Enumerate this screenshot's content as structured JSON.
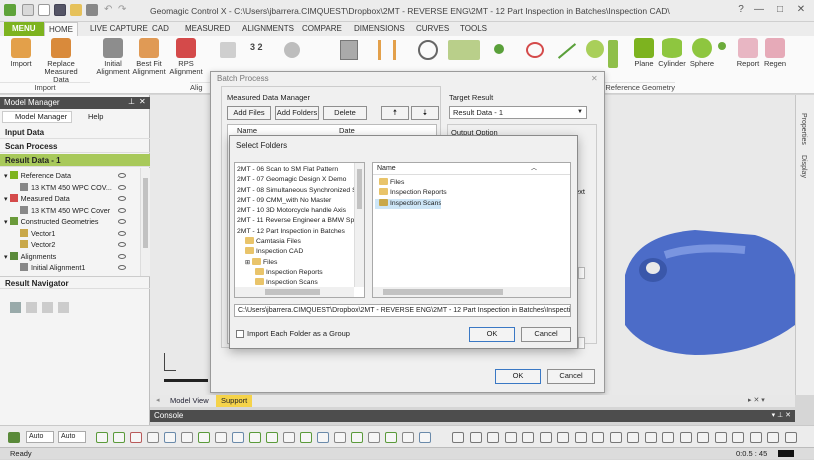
{
  "app": {
    "title": "Geomagic Control X - C:\\Users\\jbarrera.CIMQUEST\\Dropbox\\2MT - REVERSE ENG\\2MT - 12 Part Inspection in Batches\\Inspection CAD\\Inspection Complete.CXProj - [NOT FOR RESALE]"
  },
  "ribbon": {
    "tabs": [
      "MENU",
      "HOME",
      "LIVE CAPTURE",
      "CAD",
      "MEASURED",
      "ALIGNMENTS",
      "COMPARE",
      "DIMENSIONS",
      "CURVES",
      "TOOLS"
    ],
    "buttons": [
      {
        "label": "Import",
        "icon": "import-icon"
      },
      {
        "label": "Replace Measured Data",
        "icon": "replace-data-icon"
      },
      {
        "label": "Initial Alignment",
        "icon": "initial-alignment-icon"
      },
      {
        "label": "Best Fit Alignment",
        "icon": "best-fit-icon"
      },
      {
        "label": "RPS Alignment",
        "icon": "rps-alignment-icon"
      },
      {
        "label": "Plane",
        "icon": "plane-icon"
      },
      {
        "label": "Cylinder",
        "icon": "cylinder-icon"
      },
      {
        "label": "Sphere",
        "icon": "sphere-icon"
      },
      {
        "label": "Report",
        "icon": "report-icon"
      },
      {
        "label": "Regen",
        "icon": "regen-icon"
      }
    ],
    "groups": {
      "import": "Import",
      "align": "Alig",
      "ref_geometry": "Reference Geometry"
    }
  },
  "model_manager": {
    "header": "Model Manager",
    "tabs": [
      "Model Manager",
      "Help"
    ],
    "sections": {
      "input": "Input Data",
      "scan": "Scan Process",
      "result": "Result Data - 1",
      "navigator": "Result Navigator"
    },
    "tree": [
      {
        "label": "Reference Data",
        "level": 0,
        "icon": "reference-data-icon"
      },
      {
        "label": "13 KTM 450 WPC COV...",
        "level": 1,
        "icon": "cad-body-icon"
      },
      {
        "label": "Measured Data",
        "level": 0,
        "icon": "measured-data-icon"
      },
      {
        "label": "13 KTM 450 WPC Cover",
        "level": 1,
        "icon": "mesh-icon"
      },
      {
        "label": "Constructed Geometries",
        "level": 0,
        "icon": "constructed-geometry-icon"
      },
      {
        "label": "Vector1",
        "level": 1,
        "icon": "vector-icon"
      },
      {
        "label": "Vector2",
        "level": 1,
        "icon": "vector-icon"
      },
      {
        "label": "Alignments",
        "level": 0,
        "icon": "alignments-icon"
      },
      {
        "label": "Initial Alignment1",
        "level": 1,
        "icon": "alignment-icon"
      }
    ]
  },
  "batch": {
    "title": "Batch Process",
    "measured_label": "Measured Data Manager",
    "add_files": "Add Files",
    "add_folders": "Add Folders",
    "delete": "Delete",
    "col_name": "Name",
    "col_date": "Date",
    "target_label": "Target Result",
    "target_value": "Result Data - 1",
    "output_label": "Output Option",
    "text_frag": "ext",
    "ok": "OK",
    "cancel": "Cancel"
  },
  "select_folders": {
    "title": "Select Folders",
    "tree": [
      {
        "label": "2MT - 06 Scan to SM Flat Pattern",
        "indent": 0,
        "folder": false
      },
      {
        "label": "2MT - 07 Geomagic Design X Demo",
        "indent": 0,
        "folder": false
      },
      {
        "label": "2MT - 08 Simultaneous Synchronized S",
        "indent": 0,
        "folder": false
      },
      {
        "label": "2MT - 09 CMM_with No Master",
        "indent": 0,
        "folder": false
      },
      {
        "label": "2MT - 10 3D Motorcycle handle Axis",
        "indent": 0,
        "folder": false
      },
      {
        "label": "2MT - 11 Reverse Engineer a BMW Sp",
        "indent": 0,
        "folder": false
      },
      {
        "label": "2MT - 12 Part Inspection in Batches",
        "indent": 0,
        "folder": false
      },
      {
        "label": "Camtasia Files",
        "indent": 1,
        "folder": true
      },
      {
        "label": "Inspection CAD",
        "indent": 1,
        "folder": true
      },
      {
        "label": "Files",
        "indent": 2,
        "folder": true
      },
      {
        "label": "Inspection Reports",
        "indent": 2,
        "folder": true
      },
      {
        "label": "Inspection Scans",
        "indent": 2,
        "folder": true
      }
    ],
    "list_header": "Name",
    "list": [
      {
        "label": "Files",
        "selected": false
      },
      {
        "label": "Inspection Reports",
        "selected": false
      },
      {
        "label": "Inspection Scans",
        "selected": true
      }
    ],
    "path": "C:\\Users\\jbarrera.CIMQUEST\\Dropbox\\2MT - REVERSE ENG\\2MT - 12 Part Inspection in Batches\\Inspection",
    "checkbox_label": "Import Each Folder as a Group",
    "ok": "OK",
    "cancel": "Cancel"
  },
  "view_tabs": [
    "Model View",
    "Support"
  ],
  "right_strip": [
    "Properties",
    "Display"
  ],
  "console": "Console",
  "toolbar": {
    "select1": "Auto",
    "select2": "Auto"
  },
  "status": {
    "left": "Ready",
    "time": "0:0.5 : 45"
  },
  "colors": {
    "accent": "#7db31f",
    "support_tab": "#f5d34a",
    "part_blue": "#4c6cc8",
    "folder": "#e9c46a"
  }
}
